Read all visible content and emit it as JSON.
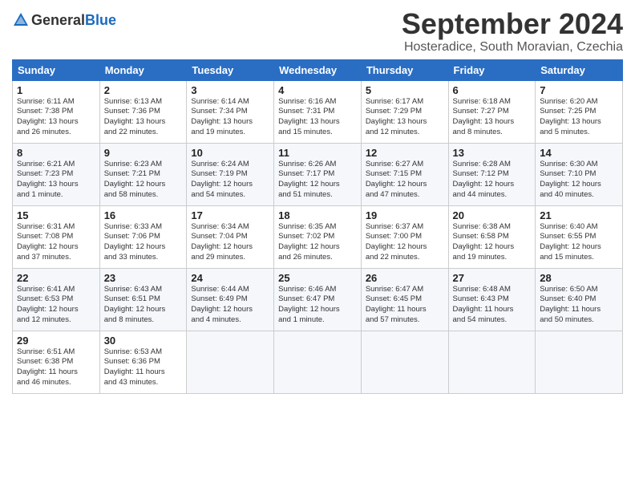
{
  "header": {
    "logo_general": "General",
    "logo_blue": "Blue",
    "title": "September 2024",
    "location": "Hosteradice, South Moravian, Czechia"
  },
  "weekdays": [
    "Sunday",
    "Monday",
    "Tuesday",
    "Wednesday",
    "Thursday",
    "Friday",
    "Saturday"
  ],
  "weeks": [
    [
      {
        "day": "1",
        "info": "Sunrise: 6:11 AM\nSunset: 7:38 PM\nDaylight: 13 hours\nand 26 minutes."
      },
      {
        "day": "2",
        "info": "Sunrise: 6:13 AM\nSunset: 7:36 PM\nDaylight: 13 hours\nand 22 minutes."
      },
      {
        "day": "3",
        "info": "Sunrise: 6:14 AM\nSunset: 7:34 PM\nDaylight: 13 hours\nand 19 minutes."
      },
      {
        "day": "4",
        "info": "Sunrise: 6:16 AM\nSunset: 7:31 PM\nDaylight: 13 hours\nand 15 minutes."
      },
      {
        "day": "5",
        "info": "Sunrise: 6:17 AM\nSunset: 7:29 PM\nDaylight: 13 hours\nand 12 minutes."
      },
      {
        "day": "6",
        "info": "Sunrise: 6:18 AM\nSunset: 7:27 PM\nDaylight: 13 hours\nand 8 minutes."
      },
      {
        "day": "7",
        "info": "Sunrise: 6:20 AM\nSunset: 7:25 PM\nDaylight: 13 hours\nand 5 minutes."
      }
    ],
    [
      {
        "day": "8",
        "info": "Sunrise: 6:21 AM\nSunset: 7:23 PM\nDaylight: 13 hours\nand 1 minute."
      },
      {
        "day": "9",
        "info": "Sunrise: 6:23 AM\nSunset: 7:21 PM\nDaylight: 12 hours\nand 58 minutes."
      },
      {
        "day": "10",
        "info": "Sunrise: 6:24 AM\nSunset: 7:19 PM\nDaylight: 12 hours\nand 54 minutes."
      },
      {
        "day": "11",
        "info": "Sunrise: 6:26 AM\nSunset: 7:17 PM\nDaylight: 12 hours\nand 51 minutes."
      },
      {
        "day": "12",
        "info": "Sunrise: 6:27 AM\nSunset: 7:15 PM\nDaylight: 12 hours\nand 47 minutes."
      },
      {
        "day": "13",
        "info": "Sunrise: 6:28 AM\nSunset: 7:12 PM\nDaylight: 12 hours\nand 44 minutes."
      },
      {
        "day": "14",
        "info": "Sunrise: 6:30 AM\nSunset: 7:10 PM\nDaylight: 12 hours\nand 40 minutes."
      }
    ],
    [
      {
        "day": "15",
        "info": "Sunrise: 6:31 AM\nSunset: 7:08 PM\nDaylight: 12 hours\nand 37 minutes."
      },
      {
        "day": "16",
        "info": "Sunrise: 6:33 AM\nSunset: 7:06 PM\nDaylight: 12 hours\nand 33 minutes."
      },
      {
        "day": "17",
        "info": "Sunrise: 6:34 AM\nSunset: 7:04 PM\nDaylight: 12 hours\nand 29 minutes."
      },
      {
        "day": "18",
        "info": "Sunrise: 6:35 AM\nSunset: 7:02 PM\nDaylight: 12 hours\nand 26 minutes."
      },
      {
        "day": "19",
        "info": "Sunrise: 6:37 AM\nSunset: 7:00 PM\nDaylight: 12 hours\nand 22 minutes."
      },
      {
        "day": "20",
        "info": "Sunrise: 6:38 AM\nSunset: 6:58 PM\nDaylight: 12 hours\nand 19 minutes."
      },
      {
        "day": "21",
        "info": "Sunrise: 6:40 AM\nSunset: 6:55 PM\nDaylight: 12 hours\nand 15 minutes."
      }
    ],
    [
      {
        "day": "22",
        "info": "Sunrise: 6:41 AM\nSunset: 6:53 PM\nDaylight: 12 hours\nand 12 minutes."
      },
      {
        "day": "23",
        "info": "Sunrise: 6:43 AM\nSunset: 6:51 PM\nDaylight: 12 hours\nand 8 minutes."
      },
      {
        "day": "24",
        "info": "Sunrise: 6:44 AM\nSunset: 6:49 PM\nDaylight: 12 hours\nand 4 minutes."
      },
      {
        "day": "25",
        "info": "Sunrise: 6:46 AM\nSunset: 6:47 PM\nDaylight: 12 hours\nand 1 minute."
      },
      {
        "day": "26",
        "info": "Sunrise: 6:47 AM\nSunset: 6:45 PM\nDaylight: 11 hours\nand 57 minutes."
      },
      {
        "day": "27",
        "info": "Sunrise: 6:48 AM\nSunset: 6:43 PM\nDaylight: 11 hours\nand 54 minutes."
      },
      {
        "day": "28",
        "info": "Sunrise: 6:50 AM\nSunset: 6:40 PM\nDaylight: 11 hours\nand 50 minutes."
      }
    ],
    [
      {
        "day": "29",
        "info": "Sunrise: 6:51 AM\nSunset: 6:38 PM\nDaylight: 11 hours\nand 46 minutes."
      },
      {
        "day": "30",
        "info": "Sunrise: 6:53 AM\nSunset: 6:36 PM\nDaylight: 11 hours\nand 43 minutes."
      },
      {
        "day": "",
        "info": ""
      },
      {
        "day": "",
        "info": ""
      },
      {
        "day": "",
        "info": ""
      },
      {
        "day": "",
        "info": ""
      },
      {
        "day": "",
        "info": ""
      }
    ]
  ]
}
